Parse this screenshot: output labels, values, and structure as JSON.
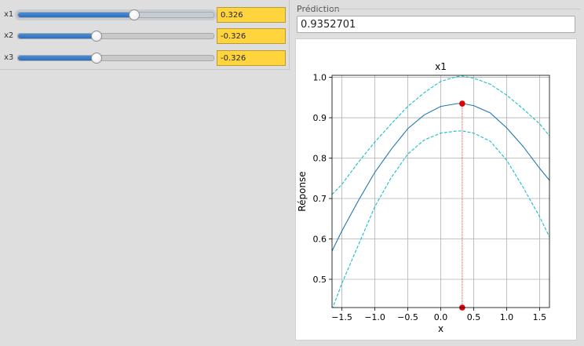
{
  "controls": [
    {
      "label": "x1",
      "value": "0.326",
      "fraction": 0.593,
      "focused": true
    },
    {
      "label": "x2",
      "value": "-0.326",
      "fraction": 0.403,
      "focused": false
    },
    {
      "label": "x3",
      "value": "-0.326",
      "fraction": 0.403,
      "focused": false
    }
  ],
  "prediction": {
    "group_title": "Prédiction",
    "value": "0.9352701"
  },
  "chart_data": {
    "type": "line",
    "title": "x1",
    "xlabel": "x",
    "ylabel": "Réponse",
    "xlim": [
      -1.65,
      1.65
    ],
    "ylim": [
      0.43,
      1.005
    ],
    "xticks": [
      -1.5,
      -1.0,
      -0.5,
      0.0,
      0.5,
      1.0,
      1.5
    ],
    "xtick_labels": [
      "−1.5",
      "−1.0",
      "−0.5",
      "0.0",
      "0.5",
      "1.0",
      "1.5"
    ],
    "yticks": [
      0.5,
      0.6,
      0.7,
      0.8,
      0.9,
      1.0
    ],
    "ytick_labels": [
      "0.5",
      "0.6",
      "0.7",
      "0.8",
      "0.9",
      "1.0"
    ],
    "grid": true,
    "x": [
      -1.65,
      -1.5,
      -1.25,
      -1.0,
      -0.75,
      -0.5,
      -0.25,
      0.0,
      0.25,
      0.33,
      0.5,
      0.75,
      1.0,
      1.25,
      1.5,
      1.65
    ],
    "series": [
      {
        "style": "solid",
        "color": "#1f77b4",
        "values": [
          0.57,
          0.62,
          0.695,
          0.765,
          0.822,
          0.873,
          0.907,
          0.928,
          0.935,
          0.935,
          0.93,
          0.912,
          0.875,
          0.829,
          0.775,
          0.745
        ]
      },
      {
        "style": "dashed",
        "color": "#17becf",
        "values": [
          0.71,
          0.735,
          0.79,
          0.84,
          0.885,
          0.928,
          0.962,
          0.99,
          1.002,
          1.003,
          0.998,
          0.983,
          0.956,
          0.922,
          0.885,
          0.855
        ]
      },
      {
        "style": "dashed",
        "color": "#17becf",
        "values": [
          0.425,
          0.49,
          0.585,
          0.68,
          0.752,
          0.81,
          0.845,
          0.862,
          0.867,
          0.867,
          0.862,
          0.842,
          0.795,
          0.728,
          0.655,
          0.605
        ]
      }
    ],
    "marker": {
      "x": 0.326,
      "y": 0.935,
      "color": "#e00000"
    },
    "vline": {
      "x": 0.326,
      "color": "#cc0000"
    }
  }
}
